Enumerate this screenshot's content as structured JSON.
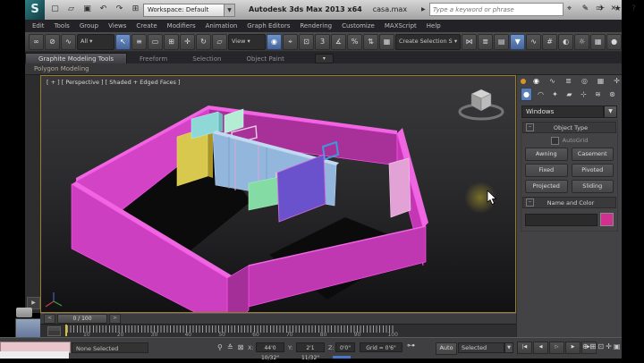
{
  "window": {
    "logo": "S",
    "workspace": "Workspace: Default",
    "title_product": "Autodesk 3ds Max 2013 x64",
    "title_file": "casa.max",
    "search_placeholder": "Type a keyword or phrase",
    "quick_icons": [
      {
        "t": "▢",
        "n": "new-scene-icon"
      },
      {
        "t": "▱",
        "n": "open-file-icon"
      },
      {
        "t": "▣",
        "n": "save-file-icon"
      },
      {
        "t": "↶",
        "n": "undo-icon"
      },
      {
        "t": "↷",
        "n": "redo-icon"
      },
      {
        "t": "⊞",
        "n": "project-folder-icon"
      }
    ],
    "title_icons": [
      {
        "t": "⌖",
        "n": "search-communication-icon"
      },
      {
        "t": "✎",
        "n": "workspaces-icon"
      },
      {
        "t": "✈",
        "n": "communication-center-icon"
      },
      {
        "t": "★",
        "n": "favorites-icon"
      },
      {
        "t": "?",
        "n": "help-icon"
      }
    ],
    "window_controls": [
      {
        "t": "–",
        "n": "minimize-button"
      },
      {
        "t": "▭",
        "n": "restore-button"
      },
      {
        "t": "×",
        "n": "close-button"
      }
    ]
  },
  "menu": {
    "items": [
      "Edit",
      "Tools",
      "Group",
      "Views",
      "Create",
      "Modifiers",
      "Animation",
      "Graph Editors",
      "Rendering",
      "Customize",
      "MAXScript",
      "Help"
    ]
  },
  "toolbar": {
    "items": [
      {
        "t": "∞",
        "n": "select-link-icon"
      },
      {
        "t": "⊘",
        "n": "unlink-icon"
      },
      {
        "t": "∿",
        "n": "bind-spacewarp-icon"
      },
      {
        "t": "All ▾",
        "c": "dd",
        "n": "selection-filter-dropdown"
      },
      {
        "t": "↖",
        "c": "on",
        "n": "select-object-icon"
      },
      {
        "t": "≡",
        "n": "select-by-name-icon"
      },
      {
        "t": "▭",
        "n": "rect-selection-region-icon"
      },
      {
        "t": "⊞",
        "n": "window-crossing-icon"
      },
      {
        "t": "✛",
        "n": "select-move-icon"
      },
      {
        "t": "↻",
        "n": "select-rotate-icon"
      },
      {
        "t": "▱",
        "n": "select-scale-icon"
      },
      {
        "t": "View ▾",
        "c": "dd",
        "n": "reference-coordinate-dropdown"
      },
      {
        "t": "◉",
        "c": "on",
        "n": "use-pivot-center-icon"
      },
      {
        "t": "⌖",
        "n": "select-manipulate-icon"
      },
      {
        "t": "⊡",
        "n": "keyboard-override-icon"
      },
      {
        "t": "3",
        "n": "snaps-toggle-icon"
      },
      {
        "t": "∡",
        "n": "angle-snap-icon"
      },
      {
        "t": "%",
        "n": "percent-snap-icon"
      },
      {
        "t": "⇅",
        "n": "spinner-snap-icon"
      },
      {
        "t": "▦",
        "n": "named-selection-sets-icon"
      },
      {
        "t": "Create Selection S ▾",
        "c": "dd",
        "n": "named-selection-dropdown"
      },
      {
        "t": "⋈",
        "n": "mirror-icon"
      },
      {
        "t": "≣",
        "n": "align-icon"
      },
      {
        "t": "▤",
        "n": "manage-layers-icon"
      },
      {
        "t": "▼",
        "c": "on",
        "n": "ribbon-toggle-icon"
      },
      {
        "t": "∿",
        "n": "curve-editor-icon"
      },
      {
        "t": "#",
        "n": "schematic-view-icon"
      },
      {
        "t": "◐",
        "n": "material-editor-icon"
      },
      {
        "t": "☼",
        "n": "render-setup-icon"
      },
      {
        "t": "▦",
        "n": "rendered-frame-icon"
      },
      {
        "t": "●",
        "n": "render-production-icon"
      }
    ]
  },
  "ribbon": {
    "tabs": [
      {
        "label": "Graphite Modeling Tools",
        "active": true,
        "n": "tab-graphite-modeling-tools"
      },
      {
        "label": "Freeform",
        "n": "tab-freeform"
      },
      {
        "label": "Selection",
        "n": "tab-selection"
      },
      {
        "label": "Object Paint",
        "n": "tab-object-paint"
      },
      {
        "label": "▾",
        "c": "mini",
        "n": "ribbon-config-button"
      }
    ],
    "panel_label": "Polygon Modeling"
  },
  "viewport": {
    "label": "[ + ] [ Perspective ] [ Shaded + Edged Faces ]",
    "model_colors": {
      "outer_walls": "#cc3fc0",
      "wall_top": "#ee66e0",
      "yellow_wall": "#d8c84e",
      "cyan_wall": "#8fd8d8",
      "mint_wall": "#b4ecd4",
      "blue_wall": "#93b6dc",
      "window_frame_blue": "#3f96dc",
      "green_wall": "#84dca4",
      "purple_wall": "#6a52cc",
      "pink_door": "#e2a2d6"
    }
  },
  "command_panel": {
    "pin": "panel-dot",
    "tabs": [
      {
        "t": "◉",
        "c": "on",
        "n": "create-tab"
      },
      {
        "t": "∿",
        "n": "modify-tab"
      },
      {
        "t": "≣",
        "n": "hierarchy-tab"
      },
      {
        "t": "◎",
        "n": "motion-tab"
      },
      {
        "t": "▦",
        "n": "display-tab"
      },
      {
        "t": "✛",
        "n": "utilities-tab"
      }
    ],
    "subtabs": [
      {
        "t": "●",
        "c": "on",
        "n": "geometry-subtab"
      },
      {
        "t": "◠",
        "n": "shapes-subtab"
      },
      {
        "t": "✦",
        "n": "lights-subtab"
      },
      {
        "t": "▰",
        "n": "cameras-subtab"
      },
      {
        "t": "⊹",
        "n": "helpers-subtab"
      },
      {
        "t": "≋",
        "n": "spacewarps-subtab"
      },
      {
        "t": "⊛",
        "n": "systems-subtab"
      }
    ],
    "category_dropdown": "Windows",
    "object_type": {
      "collapse": "–",
      "title": "Object Type",
      "autogrid": "AutoGrid",
      "buttons": [
        "Awning",
        "Casement",
        "Fixed",
        "Pivoted",
        "Projected",
        "Sliding"
      ]
    },
    "name_color": {
      "collapse": "–",
      "title": "Name and Color",
      "swatch_color": "#d0308e"
    }
  },
  "timeline": {
    "prev": "<",
    "slider": "0 / 100",
    "next": ">",
    "tick_labels": [
      "10",
      "20",
      "30",
      "40",
      "50",
      "60",
      "70",
      "80",
      "90",
      "100"
    ]
  },
  "status_bar": {
    "selection": "None Selected",
    "icons": [
      {
        "t": "⚲",
        "n": "selection-lock-pin-icon"
      },
      {
        "t": "≙",
        "n": "selection-lock-icon"
      },
      {
        "t": "⊠",
        "n": "absolute-offset-toggle-icon"
      }
    ],
    "x_label": "X:",
    "x_value": "44'0 10/32\"",
    "y_label": "Y:",
    "y_value": "2'1 11/32\"",
    "z_label": "Z:",
    "z_value": "0'0\"",
    "grid": "Grid = 0'6\"",
    "key_icon": "⊶",
    "auto": "Auto",
    "key_mode": "Selected",
    "playback": [
      {
        "t": "|◀",
        "n": "go-to-start-button"
      },
      {
        "t": "◀",
        "n": "prev-frame-button"
      },
      {
        "t": "▷",
        "n": "play-button"
      },
      {
        "t": "▶",
        "n": "next-frame-button"
      },
      {
        "t": "▶|",
        "n": "go-to-end-button"
      }
    ],
    "nav_icons": [
      {
        "t": "⊕",
        "n": "zoom-icon"
      },
      {
        "t": "⊞",
        "n": "zoom-all-icon"
      },
      {
        "t": "⊡",
        "n": "zoom-extents-icon"
      },
      {
        "t": "✛",
        "n": "pan-icon"
      },
      {
        "t": "▣",
        "n": "maximize-viewport-icon"
      }
    ]
  }
}
